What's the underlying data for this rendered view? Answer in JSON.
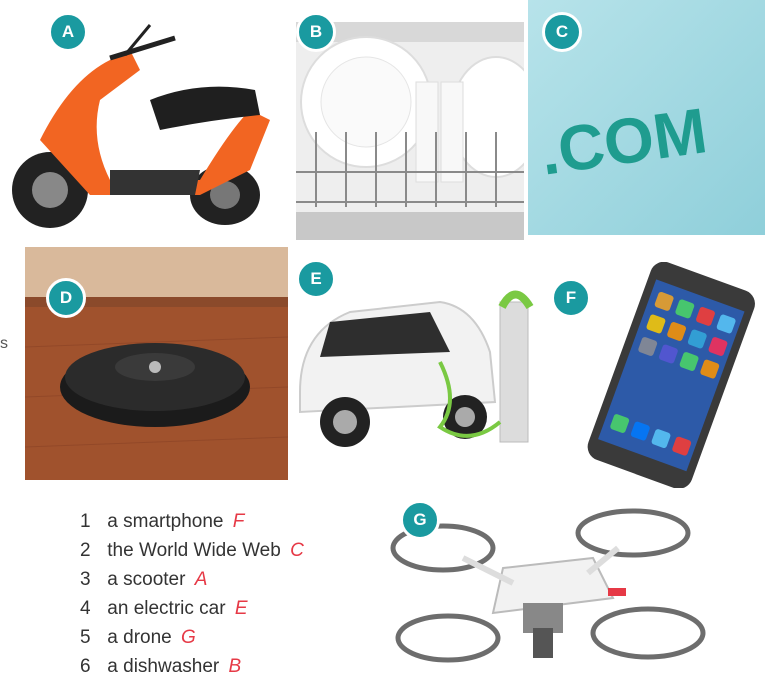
{
  "badges": {
    "a": "A",
    "b": "B",
    "c": "C",
    "d": "D",
    "e": "E",
    "f": "F",
    "g": "G"
  },
  "photo_c_text": ".COM",
  "stray_char": "s",
  "items": [
    {
      "num": "1",
      "text": "a smartphone",
      "answer": "F"
    },
    {
      "num": "2",
      "text": "the World Wide Web",
      "answer": "C"
    },
    {
      "num": "3",
      "text": "a scooter",
      "answer": "A"
    },
    {
      "num": "4",
      "text": "an electric car",
      "answer": "E"
    },
    {
      "num": "5",
      "text": "a drone",
      "answer": "G"
    },
    {
      "num": "6",
      "text": "a dishwasher",
      "answer": "B"
    }
  ],
  "colors": {
    "badge": "#1a9aa0",
    "answer": "#e63946"
  }
}
